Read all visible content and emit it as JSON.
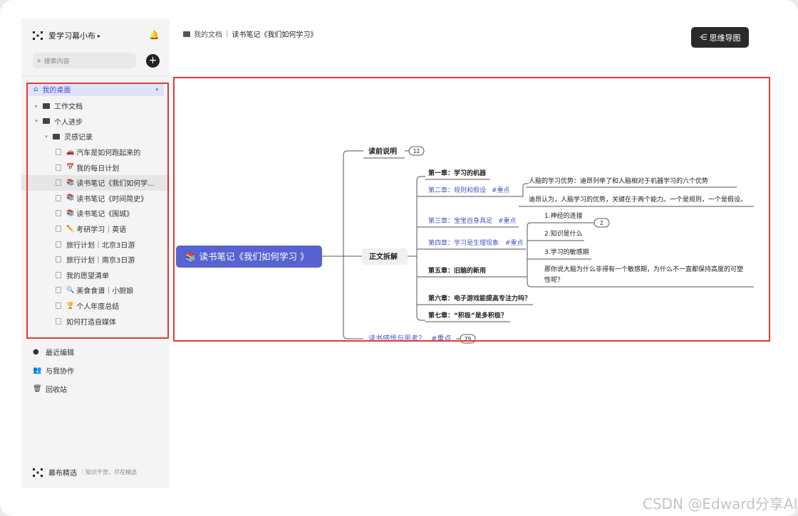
{
  "sidebar": {
    "workspace_name": "爱学习幕小布",
    "workspace_caret": "▸",
    "search_placeholder": "搜索内容",
    "tree": [
      {
        "label": "我的桌面",
        "type": "desk"
      },
      {
        "label": "工作文档",
        "type": "folder",
        "depth": 0,
        "caret": "▸"
      },
      {
        "label": "个人进步",
        "type": "folder",
        "depth": 0,
        "caret": "▾"
      },
      {
        "label": "灵感记录",
        "type": "folder",
        "depth": 1,
        "caret": "▾"
      },
      {
        "label": "汽车是如何跑起来的",
        "type": "doc",
        "emoji": "🚗"
      },
      {
        "label": "我的每日计划",
        "type": "doc",
        "emoji": "📅"
      },
      {
        "label": "读书笔记《我们如何学...",
        "type": "doc",
        "emoji": "📚",
        "active": true
      },
      {
        "label": "读书笔记《时间简史》",
        "type": "doc",
        "emoji": "📚"
      },
      {
        "label": "读书笔记《围城》",
        "type": "doc",
        "emoji": "📚"
      },
      {
        "label": "考研学习｜英语",
        "type": "doc",
        "emoji": "✏️"
      },
      {
        "label": "旅行计划｜北京3日游",
        "type": "doc"
      },
      {
        "label": "旅行计划｜南京3日游",
        "type": "doc"
      },
      {
        "label": "我的愿望清单",
        "type": "doc"
      },
      {
        "label": "美食食谱｜小厨娘",
        "type": "doc",
        "emoji": "🔍"
      },
      {
        "label": "个人年度总结",
        "type": "doc",
        "emoji": "🏆"
      },
      {
        "label": "如何打造自媒体",
        "type": "doc"
      }
    ],
    "nav": [
      {
        "label": "最近编辑",
        "icon": "clock-icon",
        "glyph": "●"
      },
      {
        "label": "与我协作",
        "icon": "users-icon",
        "glyph": "👥"
      },
      {
        "label": "回收站",
        "icon": "trash-icon",
        "glyph": "🗑"
      }
    ],
    "footer_title": "幕布精选",
    "footer_sub": "｜知识干货，尽在精选"
  },
  "breadcrumb": {
    "root": "我的文档",
    "current": "读书笔记《我们如何学习》"
  },
  "mindmap_button": "思维导图",
  "mindmap": {
    "root": "📚 读书笔记《我们如何学习 》",
    "tag": "#重点",
    "branches": [
      {
        "label": "读前说明",
        "badge": "12"
      },
      {
        "label": "正文拆解"
      },
      {
        "label": "读书感悟与思考？",
        "tag": "#重点",
        "badge": "79"
      }
    ],
    "chapters": [
      {
        "label": "第一章：学习的机器"
      },
      {
        "label": "第二章：规则和假设",
        "tag": "#重点"
      },
      {
        "label": "第三章：宝宝自身具足",
        "tag": "#重点"
      },
      {
        "label": "第四章：学习是生理现象",
        "tag": "#重点"
      },
      {
        "label": "第五章：旧脑的新用"
      },
      {
        "label": "第六章：电子游戏能提高专注力吗？"
      },
      {
        "label": "第七章：“积极”是多积极？"
      }
    ],
    "ch2_notes": [
      "人脑的学习优势：迪昂列举了和人脑相对于机器学习的六个优势",
      "迪昂认为，人脑学习的优势，关键在于两个能力。一个是规则，一个是假设。"
    ],
    "ch5_notes": [
      "1.神经的连接",
      "2.知识是什么",
      "3.学习的敏感期"
    ],
    "ch5_badge": "2",
    "ch5_question": [
      "那你说大脑为什么非得有一个敏感期，为什么不一直都保持高度的可塑",
      "性呢？"
    ]
  },
  "watermark": "CSDN @Edward分享AI"
}
